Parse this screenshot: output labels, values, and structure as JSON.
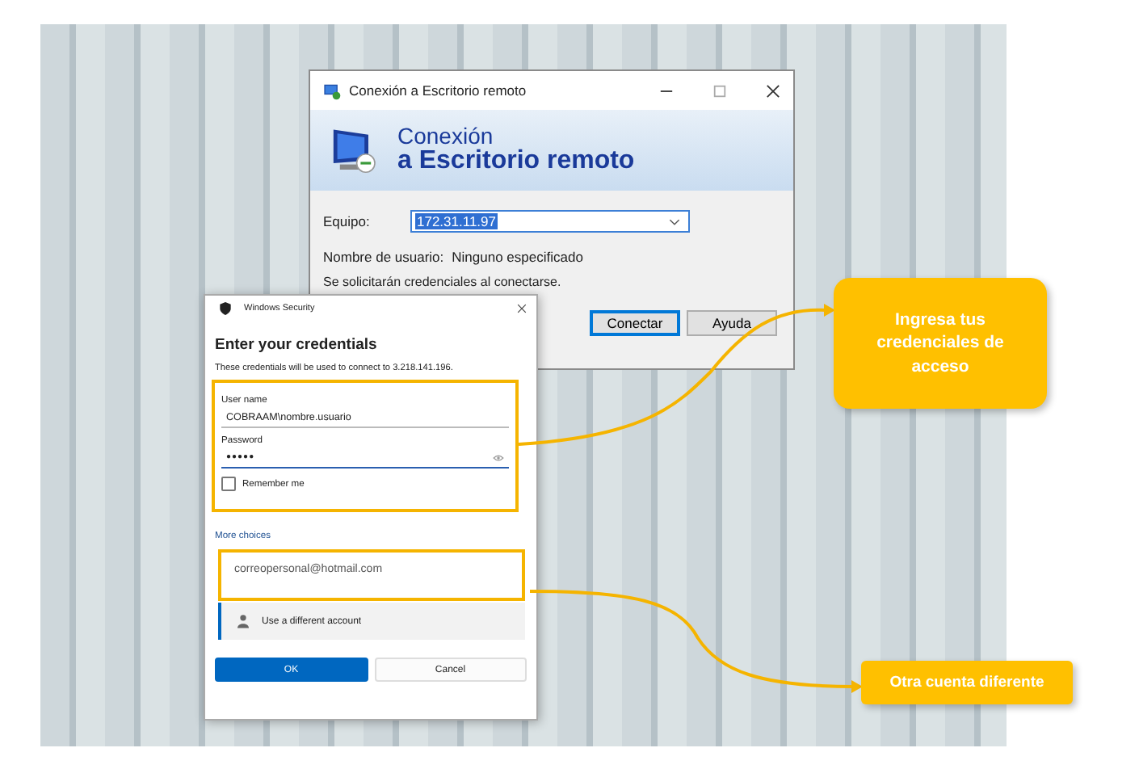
{
  "rdp_window": {
    "title": "Conexión a Escritorio remoto",
    "heading_line_1": "Conexión",
    "heading_line_2": "a Escritorio remoto",
    "computer_label": "Equipo:",
    "computer_value": "172.31.11.97",
    "user_label": "Nombre de usuario:",
    "user_value": "Ninguno especificado",
    "note": "Se solicitarán credenciales al conectarse.",
    "buttons": [
      {
        "label": "Conectar",
        "kind": "default"
      },
      {
        "label": "Ayuda",
        "kind": "normal"
      }
    ]
  },
  "security_dialog": {
    "title": "Windows Security",
    "heading": "Enter your credentials",
    "description": "These credentials will be used to connect to 3.218.141.196.",
    "fields": [
      {
        "label": "User name",
        "value": "COBRAAM\\nombre.usuario",
        "kind": "text"
      },
      {
        "label": "Password",
        "value": "●●●●●",
        "kind": "password"
      }
    ],
    "remember": {
      "label": "Remember me",
      "checked": false
    },
    "more_choices": "More choices",
    "accounts": [
      {
        "label": "correopersonal@hotmail.com",
        "kind": "email",
        "selected": false
      },
      {
        "label": "Use a different account",
        "kind": "person",
        "selected": true
      }
    ],
    "buttons": [
      {
        "label": "OK",
        "kind": "primary"
      },
      {
        "label": "Cancel",
        "kind": "secondary"
      }
    ]
  },
  "callouts": [
    {
      "text": "Ingresa tus credenciales de acceso"
    },
    {
      "text": "Otra cuenta diferente"
    }
  ]
}
